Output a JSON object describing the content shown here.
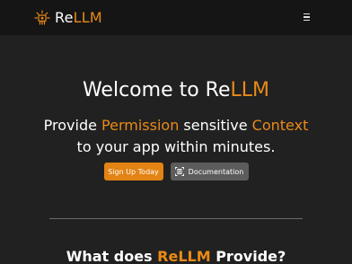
{
  "nav": {
    "logo_icon": "sun-chip-logo-icon",
    "brand_prefix": "Re",
    "brand_accent": "LLM",
    "menu_icon": "hamburger-menu-icon"
  },
  "hero": {
    "title_prefix": "Welcome to Re",
    "title_accent": "LLM",
    "subtitle_part1": "Provide ",
    "subtitle_accent1": "Permission",
    "subtitle_part2": " sensitive ",
    "subtitle_accent2": "Context",
    "subtitle_part3": " to your app within minutes."
  },
  "actions": {
    "signup_label": "Sign Up Today",
    "docs_label": "Documentation",
    "docs_icon": "document-scan-icon"
  },
  "section": {
    "title_prefix": "What does ",
    "title_accent": "ReLLM",
    "title_suffix": " Provide?"
  },
  "colors": {
    "accent": "#ea8a17",
    "background": "#212121",
    "navbar": "#151515",
    "button_primary": "#e28314",
    "button_secondary": "#5c5c5c"
  }
}
